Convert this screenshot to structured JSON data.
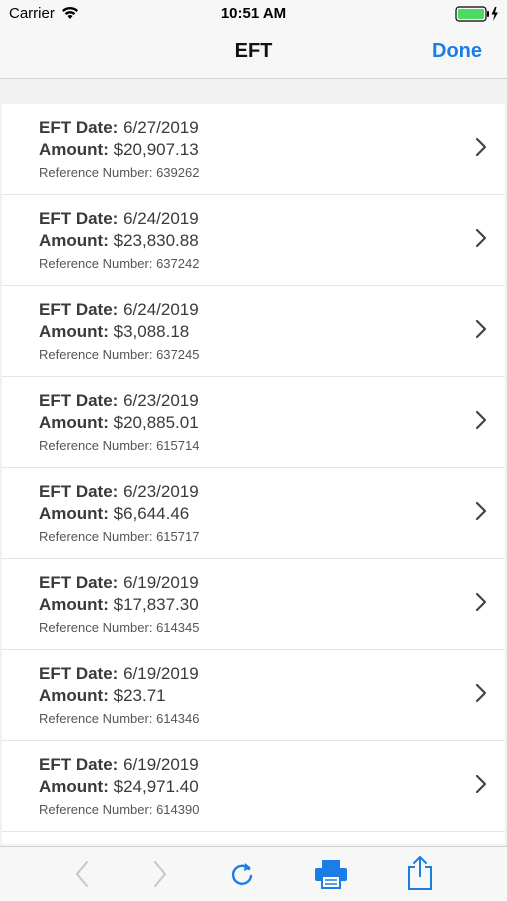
{
  "status": {
    "carrier": "Carrier",
    "time": "10:51 AM"
  },
  "nav": {
    "title": "EFT",
    "done_label": "Done"
  },
  "labels": {
    "date": "EFT Date:",
    "amount": "Amount:",
    "reference": "Reference Number:"
  },
  "rows": [
    {
      "date": "6/27/2019",
      "amount": "$20,907.13",
      "reference": "639262"
    },
    {
      "date": "6/24/2019",
      "amount": "$23,830.88",
      "reference": "637242"
    },
    {
      "date": "6/24/2019",
      "amount": "$3,088.18",
      "reference": "637245"
    },
    {
      "date": "6/23/2019",
      "amount": "$20,885.01",
      "reference": "615714"
    },
    {
      "date": "6/23/2019",
      "amount": "$6,644.46",
      "reference": "615717"
    },
    {
      "date": "6/19/2019",
      "amount": "$17,837.30",
      "reference": "614345"
    },
    {
      "date": "6/19/2019",
      "amount": "$23.71",
      "reference": "614346"
    },
    {
      "date": "6/19/2019",
      "amount": "$24,971.40",
      "reference": "614390"
    }
  ],
  "colors": {
    "accent": "#1b7ee6",
    "battery": "#4cd964",
    "disabled": "#c7c7cc"
  },
  "toolbar": {
    "icons": [
      "back-arrow-icon",
      "forward-arrow-icon",
      "refresh-icon",
      "printer-icon",
      "share-icon"
    ]
  }
}
